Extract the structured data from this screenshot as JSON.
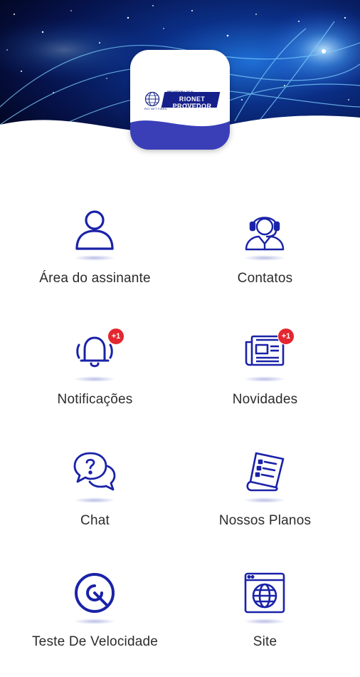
{
  "brand": {
    "name": "RIONET PROVEDOR",
    "tagline": "PROVEDOR LOCAL",
    "site": "www.rionet.net",
    "globe_caption": "RIO NET FIBRA"
  },
  "colors": {
    "primary": "#1a22a8",
    "badge": "#e3262f",
    "label": "#2b2b2b"
  },
  "menu": [
    {
      "label": "Área do assinante",
      "icon": "user-icon"
    },
    {
      "label": "Contatos",
      "icon": "headset-agent-icon"
    },
    {
      "label": "Notificações",
      "icon": "bell-icon",
      "badge": "+1"
    },
    {
      "label": "Novidades",
      "icon": "newspaper-icon",
      "badge": "+1"
    },
    {
      "label": "Chat",
      "icon": "chat-bubbles-icon"
    },
    {
      "label": "Nossos Planos",
      "icon": "plans-list-icon"
    },
    {
      "label": "Teste De Velocidade",
      "icon": "speedometer-icon"
    },
    {
      "label": "Site",
      "icon": "web-globe-icon"
    }
  ]
}
